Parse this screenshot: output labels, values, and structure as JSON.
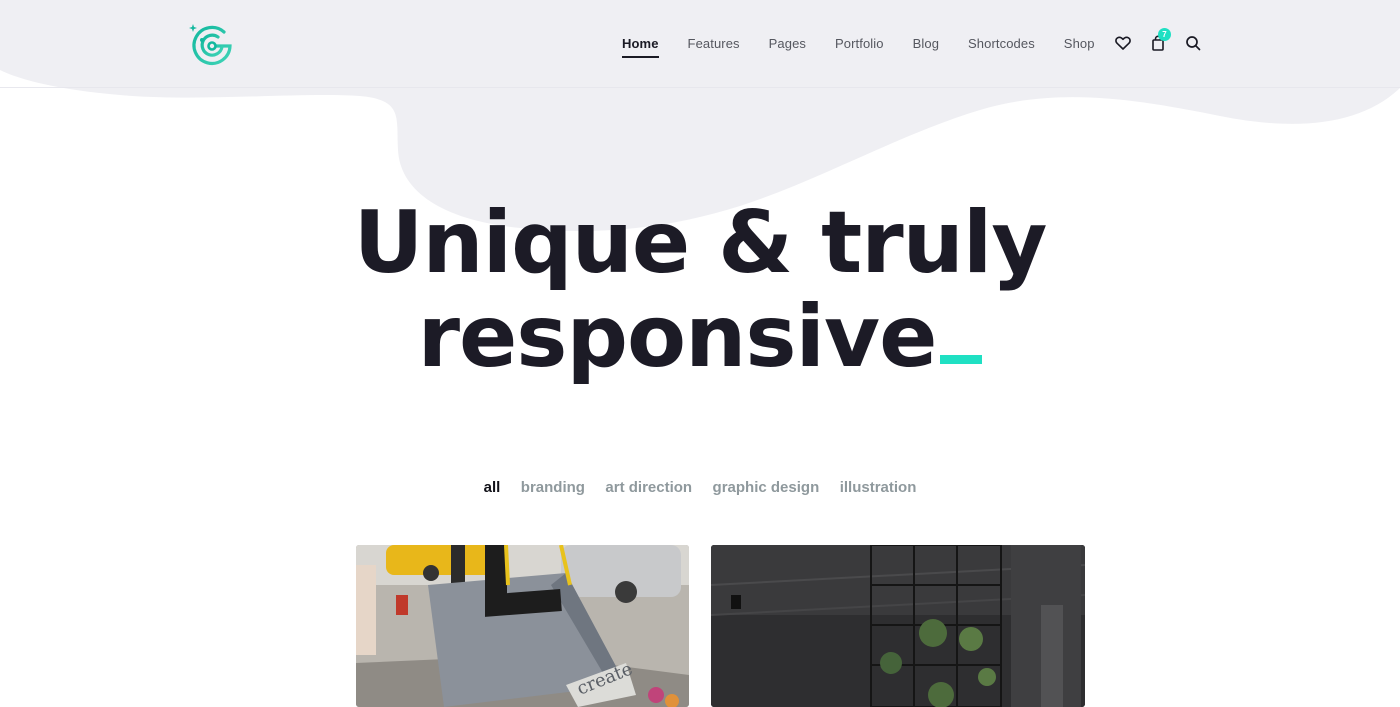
{
  "brand": {
    "logo_icon": "spiral-g-logo",
    "accent_color": "#1fe0c3"
  },
  "nav": {
    "items": [
      {
        "label": "Home",
        "active": true
      },
      {
        "label": "Features",
        "active": false
      },
      {
        "label": "Pages",
        "active": false
      },
      {
        "label": "Portfolio",
        "active": false
      },
      {
        "label": "Blog",
        "active": false
      },
      {
        "label": "Shortcodes",
        "active": false
      },
      {
        "label": "Shop",
        "active": false
      }
    ]
  },
  "header_icons": {
    "wishlist_icon": "heart-icon",
    "cart_icon": "shopping-bag-icon",
    "cart_count": "7",
    "search_icon": "search-icon"
  },
  "hero": {
    "line1": "Unique & truly",
    "line2": "responsive"
  },
  "filters": [
    {
      "label": "all",
      "active": true
    },
    {
      "label": "branding",
      "active": false
    },
    {
      "label": "art direction",
      "active": false
    },
    {
      "label": "graphic design",
      "active": false
    },
    {
      "label": "illustration",
      "active": false
    }
  ],
  "portfolio": {
    "items": [
      {
        "image": "photo-felt-tote-bag-street",
        "bag_text": "create"
      },
      {
        "image": "photo-dark-industrial-interior-shelves"
      }
    ]
  }
}
